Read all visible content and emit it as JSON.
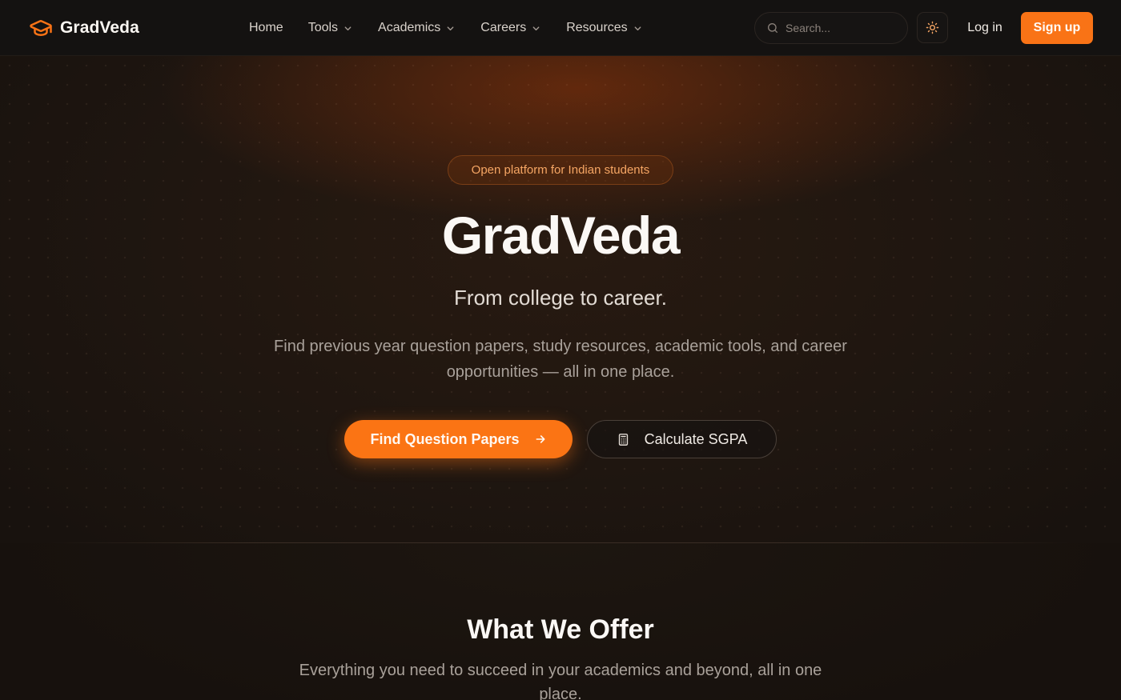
{
  "header": {
    "brand": "GradVeda",
    "nav": {
      "home": "Home",
      "tools": "Tools",
      "academics": "Academics",
      "careers": "Careers",
      "resources": "Resources"
    },
    "search_placeholder": "Search...",
    "login_label": "Log in",
    "signup_label": "Sign up"
  },
  "hero": {
    "badge": "Open platform for Indian students",
    "title": "GradVeda",
    "tagline": "From college to career.",
    "description": "Find previous year question papers, study resources, academic tools, and career opportunities — all in one place.",
    "primary_cta": "Find Question Papers",
    "secondary_cta": "Calculate SGPA"
  },
  "offer": {
    "title": "What We Offer",
    "description": "Everything you need to succeed in your academics and beyond, all in one place."
  },
  "icons": {
    "brand": "graduation-cap-icon",
    "search": "search-icon",
    "theme": "sun-icon",
    "primary_cta": "arrow-right-icon",
    "secondary_cta": "calculator-icon",
    "dropdown": "chevron-down-icon"
  },
  "colors": {
    "accent": "#f97316",
    "background": "#17110d",
    "badge_text": "#f6a664"
  }
}
